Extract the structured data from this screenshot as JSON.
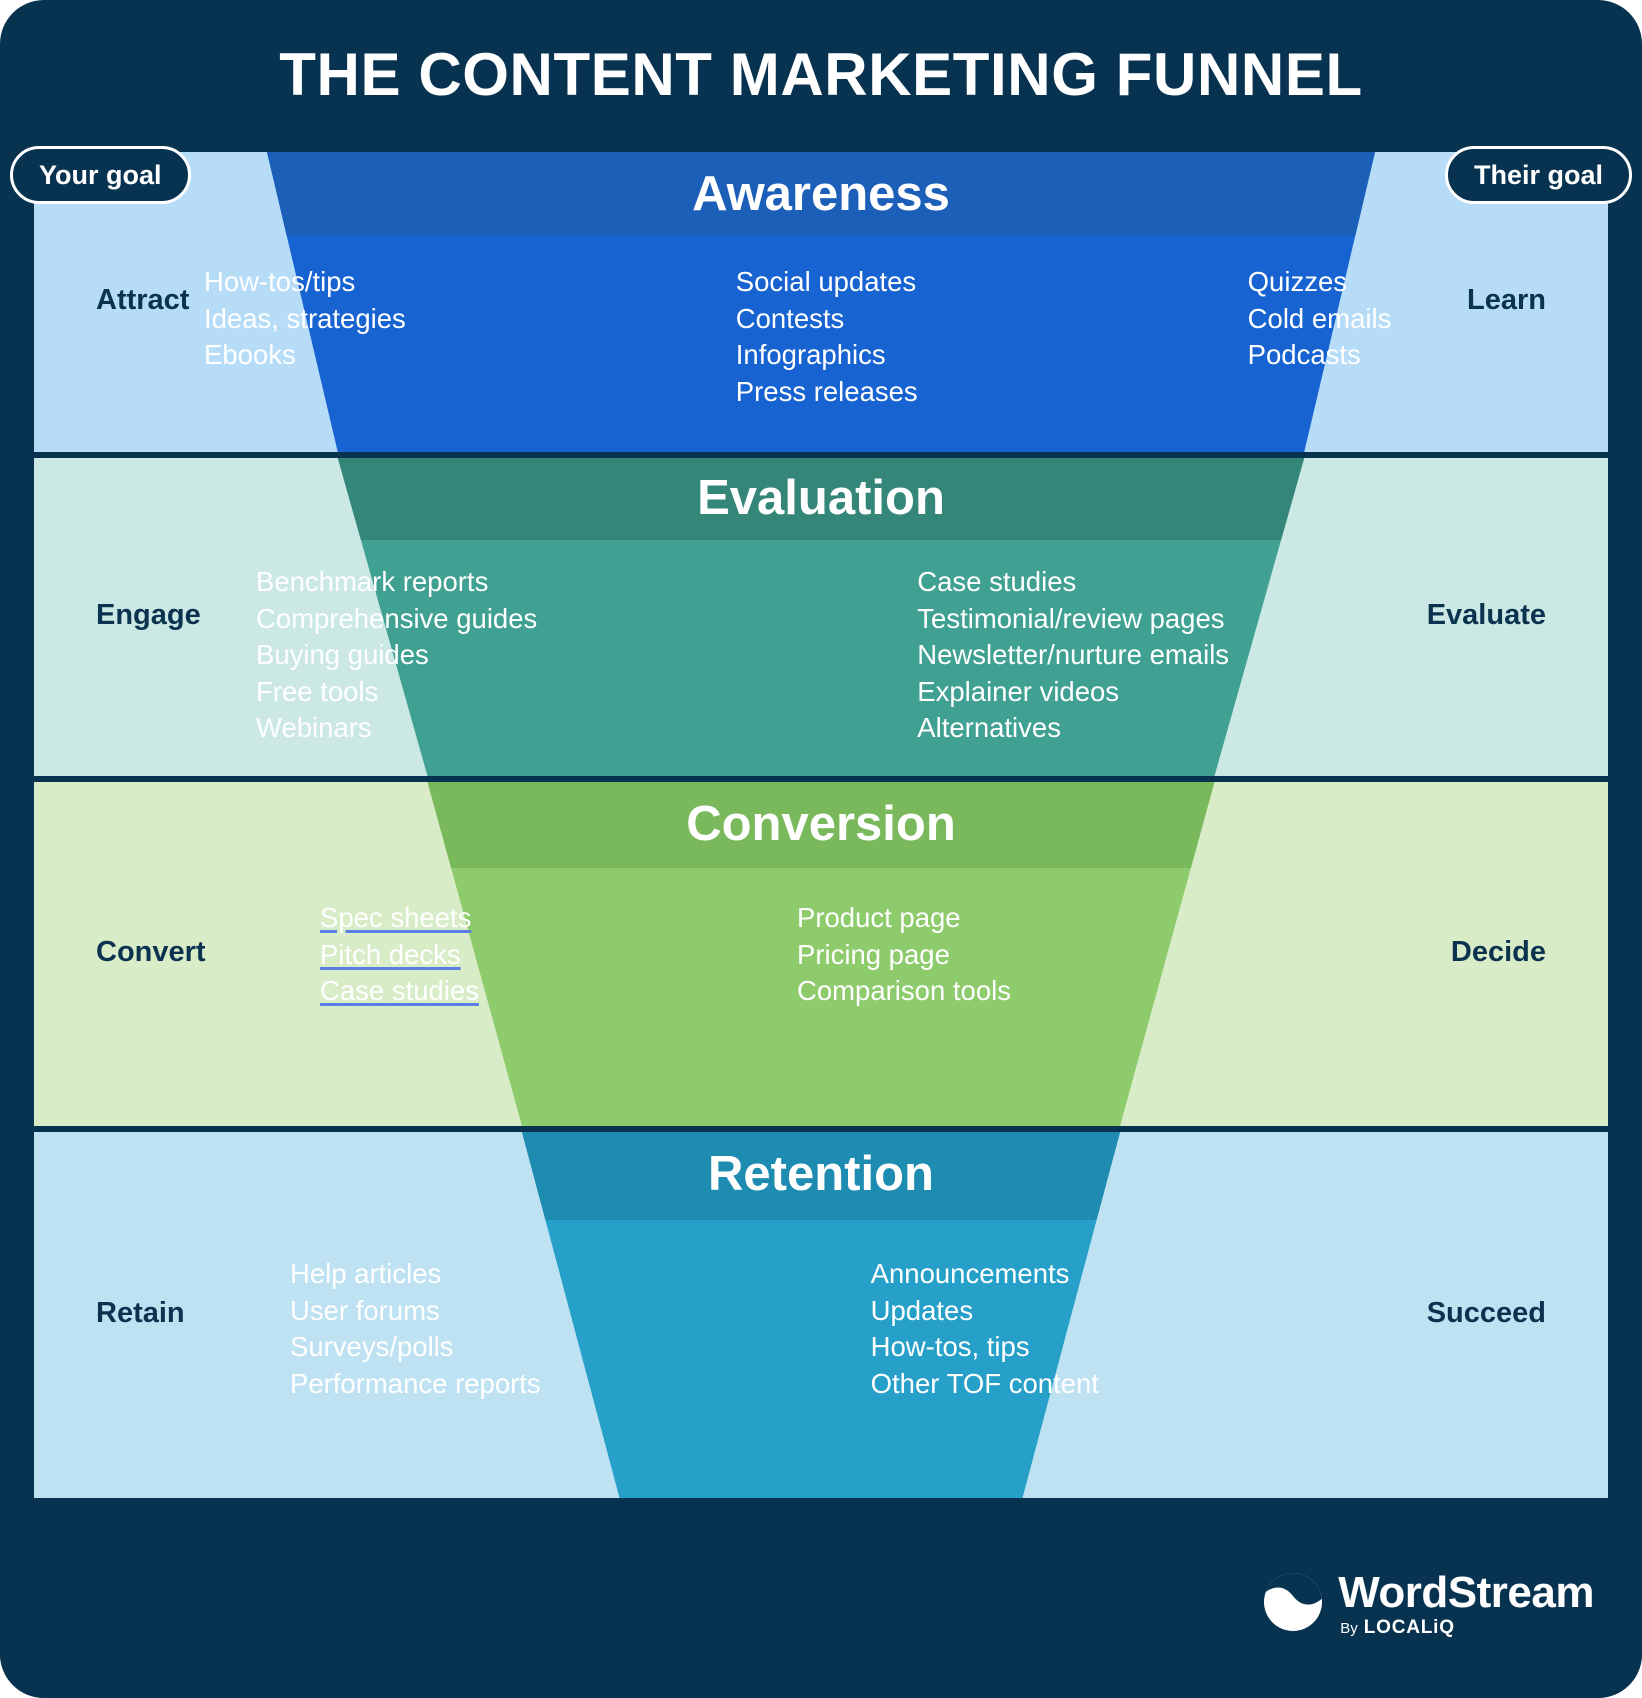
{
  "poster": {
    "title": "THE CONTENT MARKETING FUNNEL",
    "background_color": "#073351",
    "goal_left_label": "Your goal",
    "goal_right_label": "Their goal"
  },
  "footer": {
    "brand": "WordStream",
    "by": "By",
    "parent": "LOCALiQ",
    "logo_icon": "wave-circle-icon"
  },
  "stages": [
    {
      "id": "awareness",
      "title": "Awareness",
      "your_goal": "Attract",
      "their_goal": "Learn",
      "band_color": "#b7dcf8",
      "funnel_color": "#1763d1",
      "funnel_head_color": "#1b5fb8",
      "columns": [
        {
          "items": [
            "How-tos/tips",
            "Ideas, strategies",
            "Ebooks"
          ]
        },
        {
          "items": [
            "Social updates",
            "Contests",
            "Infographics",
            "Press releases"
          ]
        },
        {
          "items": [
            "Quizzes",
            "Cold emails",
            "Podcasts"
          ]
        }
      ]
    },
    {
      "id": "evaluation",
      "title": "Evaluation",
      "your_goal": "Engage",
      "their_goal": "Evaluate",
      "band_color": "#cbe8e4",
      "funnel_color": "#40a193",
      "funnel_head_color": "#348678",
      "columns": [
        {
          "items": [
            "Benchmark reports",
            "Comprehensive guides",
            "Buying guides",
            "Free tools",
            "Webinars"
          ]
        },
        {
          "items": [
            "Case studies",
            "Testimonial/review pages",
            "Newsletter/nurture emails",
            "Explainer videos",
            "Alternatives"
          ]
        }
      ]
    },
    {
      "id": "conversion",
      "title": "Conversion",
      "your_goal": "Convert",
      "their_goal": "Decide",
      "band_color": "#d9ecc8",
      "funnel_color": "#8ecb6c",
      "funnel_head_color": "#79b95c",
      "columns": [
        {
          "items": [
            "Spec sheets",
            "Pitch decks",
            "Case studies"
          ],
          "link": true
        },
        {
          "items": [
            "Product page",
            "Pricing page",
            "Comparison tools"
          ]
        }
      ]
    },
    {
      "id": "retention",
      "title": "Retention",
      "your_goal": "Retain",
      "their_goal": "Succeed",
      "band_color": "#bee2f2",
      "funnel_color": "#27a0c9",
      "funnel_head_color": "#1d8cb0",
      "columns": [
        {
          "items": [
            "Help articles",
            "User forums",
            "Surveys/polls",
            "Performance reports"
          ]
        },
        {
          "items": [
            "Announcements",
            "Updates",
            "How-tos, tips",
            "Other TOF content"
          ]
        }
      ]
    }
  ],
  "link_underline_color": "#5b7fe0"
}
